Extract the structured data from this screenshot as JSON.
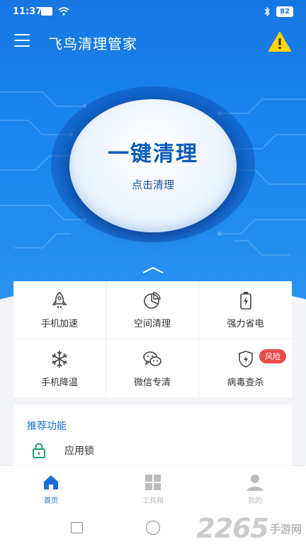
{
  "status_bar": {
    "time": "11:37",
    "battery": "82"
  },
  "app_bar": {
    "title": "飞鸟清理管家"
  },
  "clean_button": {
    "title": "一键清理",
    "subtitle": "点击清理"
  },
  "features": [
    {
      "label": "手机加速",
      "icon": "rocket-icon"
    },
    {
      "label": "空间清理",
      "icon": "pie-chart-icon"
    },
    {
      "label": "强力省电",
      "icon": "battery-icon"
    },
    {
      "label": "手机降温",
      "icon": "snowflake-icon"
    },
    {
      "label": "微信专清",
      "icon": "wechat-icon"
    },
    {
      "label": "病毒查杀",
      "icon": "shield-icon",
      "badge": "风险"
    }
  ],
  "recommend": {
    "title": "推荐功能",
    "items": [
      {
        "label": "应用锁",
        "icon": "lock-icon"
      }
    ]
  },
  "bottom_nav": [
    {
      "label": "首页",
      "icon": "home-icon",
      "active": true
    },
    {
      "label": "工具箱",
      "icon": "grid-icon",
      "active": false
    },
    {
      "label": "我的",
      "icon": "user-icon",
      "active": false
    }
  ],
  "watermark": {
    "number": "2265",
    "text": "手游网"
  },
  "colors": {
    "primary": "#1a86ee",
    "accent_text": "#1a6fd8",
    "risk": "#e84a4a",
    "lock_green": "#1aa36b"
  }
}
